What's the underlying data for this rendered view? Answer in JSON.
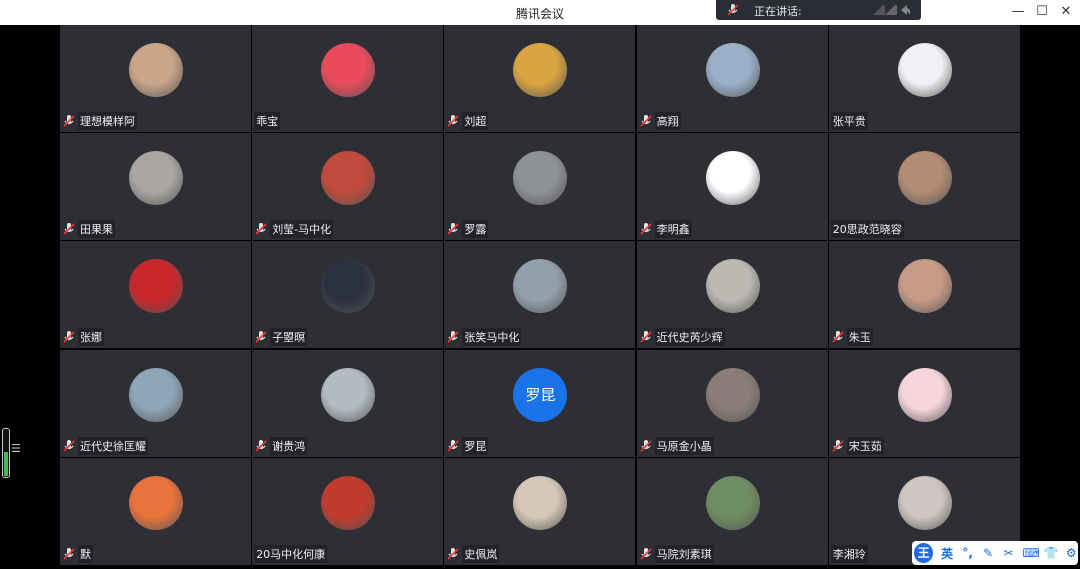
{
  "window": {
    "title": "腾讯会议",
    "minimize": "—",
    "maximize": "☐",
    "close": "✕"
  },
  "speaking": {
    "label": "正在讲话:"
  },
  "participants": [
    {
      "name": "理想模样阿",
      "muted": true,
      "avatar": "photo"
    },
    {
      "name": "乖宝",
      "muted": false,
      "avatar": "photo"
    },
    {
      "name": "刘超",
      "muted": true,
      "avatar": "photo"
    },
    {
      "name": "高翔",
      "muted": true,
      "avatar": "photo"
    },
    {
      "name": "张平贵",
      "muted": false,
      "avatar": "photo"
    },
    {
      "name": "田果果",
      "muted": true,
      "avatar": "photo"
    },
    {
      "name": "刘莹-马中化",
      "muted": true,
      "avatar": "photo"
    },
    {
      "name": "罗露",
      "muted": true,
      "avatar": "photo"
    },
    {
      "name": "李明鑫",
      "muted": true,
      "avatar": "photo"
    },
    {
      "name": "20思政范晓容",
      "muted": false,
      "avatar": "photo"
    },
    {
      "name": "张娜",
      "muted": true,
      "avatar": "photo"
    },
    {
      "name": "子曌暝",
      "muted": true,
      "avatar": "photo"
    },
    {
      "name": "张笑马中化",
      "muted": true,
      "avatar": "photo"
    },
    {
      "name": "近代史芮少辉",
      "muted": true,
      "avatar": "photo"
    },
    {
      "name": "朱玉",
      "muted": true,
      "avatar": "photo"
    },
    {
      "name": "近代史徐匡耀",
      "muted": true,
      "avatar": "photo"
    },
    {
      "name": "谢贵鸿",
      "muted": true,
      "avatar": "photo"
    },
    {
      "name": "罗昆",
      "muted": true,
      "avatar": "text",
      "avatar_text": "罗昆"
    },
    {
      "name": "马原金小晶",
      "muted": true,
      "avatar": "photo"
    },
    {
      "name": "宋玉茹",
      "muted": true,
      "avatar": "photo"
    },
    {
      "name": "默",
      "muted": true,
      "avatar": "photo"
    },
    {
      "name": "20马中化何康",
      "muted": false,
      "avatar": "photo"
    },
    {
      "name": "史佩岚",
      "muted": true,
      "avatar": "photo"
    },
    {
      "name": "马院刘素琪",
      "muted": true,
      "avatar": "photo"
    },
    {
      "name": "李湘玲",
      "muted": false,
      "avatar": "photo"
    }
  ],
  "avatar_colors": [
    "#c9a58a",
    "#e94b5c",
    "#d9a441",
    "#9ab0c8",
    "#f1f1f5",
    "#a9a6a3",
    "#c04a3b",
    "#8e9196",
    "#ffffff",
    "#b28c74",
    "#c8262b",
    "#2c3140",
    "#93a0ac",
    "#bdbab4",
    "#c79a86",
    "#8fa6b9",
    "#b3bcc2",
    "#1a73e8",
    "#8a7e76",
    "#f6d6dc",
    "#e8733b",
    "#c33a2f",
    "#d6c7b7",
    "#6f8d63",
    "#cfc6c3"
  ],
  "ime": {
    "logo": "王",
    "lang": "英",
    "icons": [
      "°,",
      "✎",
      "✂",
      "⌨",
      "👕",
      "⚙"
    ]
  }
}
